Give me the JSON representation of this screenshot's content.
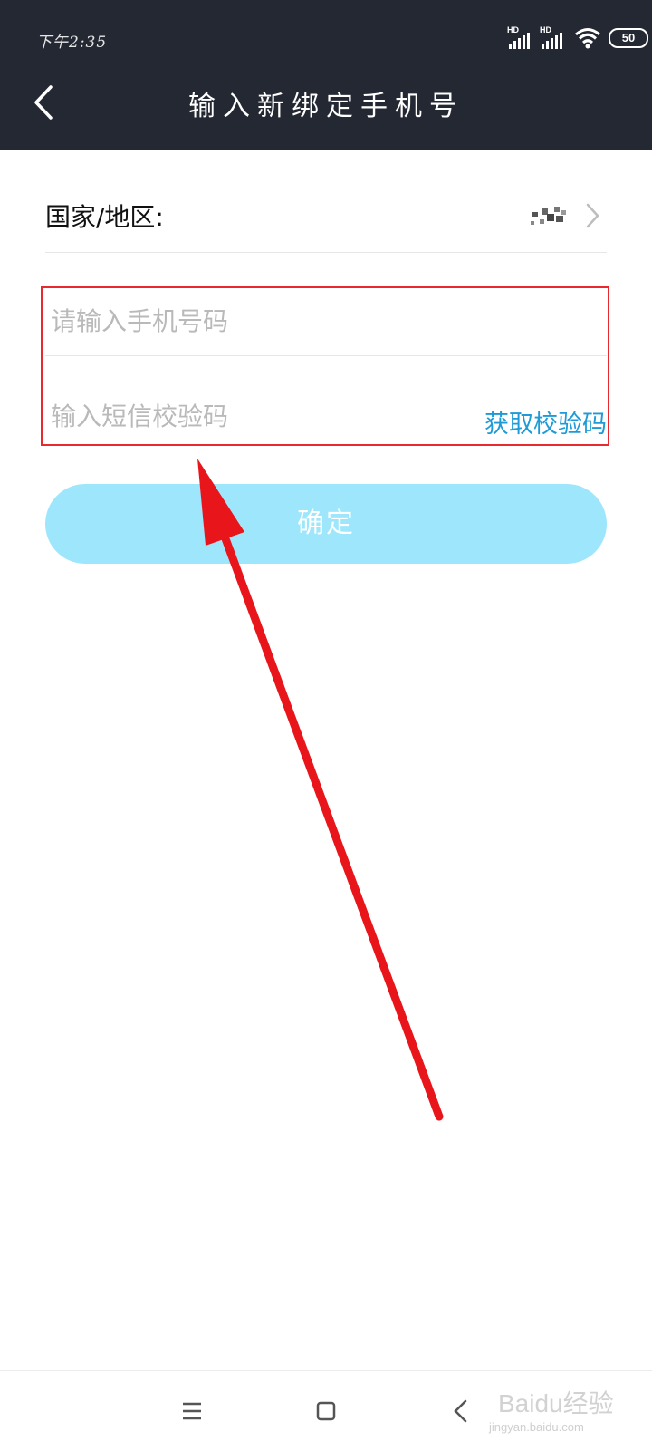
{
  "status_bar": {
    "time": "下午2:35",
    "signal_1_label": "HD",
    "signal_2_label": "HD",
    "battery": "50"
  },
  "header": {
    "title": "输入新绑定手机号"
  },
  "form": {
    "country_label": "国家/地区:",
    "phone_placeholder": "请输入手机号码",
    "code_placeholder": "输入短信校验码",
    "get_code_label": "获取校验码",
    "confirm_label": "确定"
  },
  "watermark": {
    "brand": "Baidu经验",
    "site": "jingyan.baidu.com"
  },
  "colors": {
    "header_bg": "#232833",
    "accent": "#1e9bd7",
    "confirm_bg": "#9ee6fb",
    "highlight": "#e8292d"
  }
}
